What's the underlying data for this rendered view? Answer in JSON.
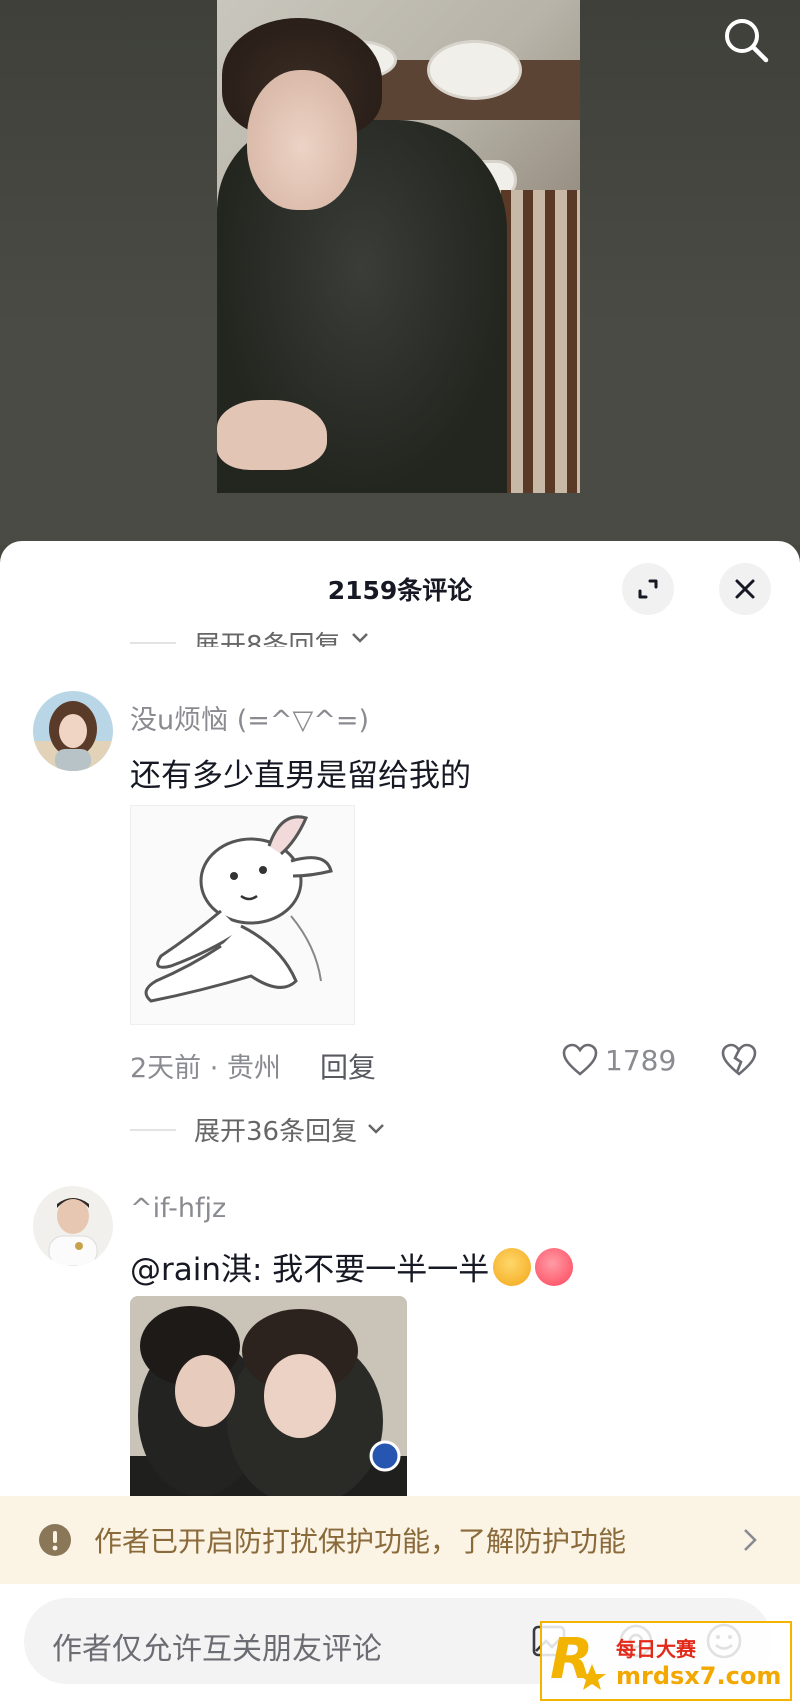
{
  "header": {
    "comment_count_title": "2159条评论"
  },
  "comments": [
    {
      "expand_label_above": "展开8条回复",
      "username": "没u烦恼 (=^▽^=)",
      "text": "还有多少直男是留给我的",
      "time_location": "2天前 · 贵州",
      "reply_label": "回复",
      "likes": "1789",
      "expand_label": "展开36条回复"
    },
    {
      "username": "^if-hfjz",
      "text": "@rain淇: 我不要一半一半"
    }
  ],
  "notice": {
    "text": "作者已开启防打扰保护功能，了解防护功能"
  },
  "input": {
    "placeholder": "作者仅允许互关朋友评论"
  },
  "watermark": {
    "top_text": "每日大赛",
    "bottom_text": "mrdsx7.com"
  },
  "colors": {
    "notice_bg": "#fbf3e4",
    "notice_text": "#8a6a3a",
    "watermark_gold": "#f2b400",
    "watermark_red": "#e22a1a"
  }
}
